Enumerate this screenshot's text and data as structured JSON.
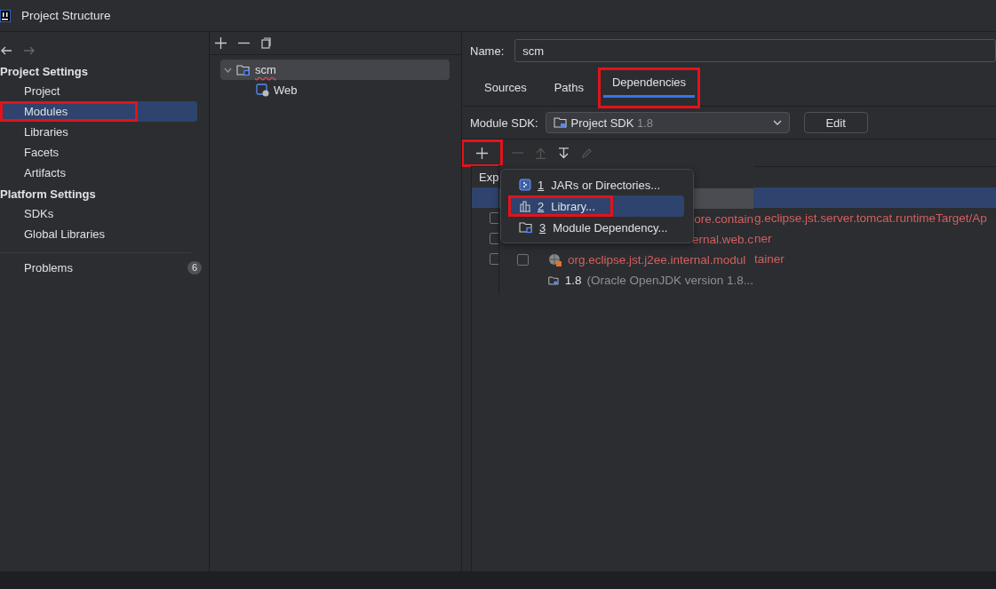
{
  "window": {
    "title": "Project Structure"
  },
  "sidebar": {
    "sections": [
      {
        "heading": "Project Settings",
        "items": [
          {
            "label": "Project",
            "selected": false,
            "highlighted": false
          },
          {
            "label": "Modules",
            "selected": true,
            "highlighted": true
          },
          {
            "label": "Libraries",
            "selected": false,
            "highlighted": false
          },
          {
            "label": "Facets",
            "selected": false,
            "highlighted": false
          },
          {
            "label": "Artifacts",
            "selected": false,
            "highlighted": false
          }
        ]
      },
      {
        "heading": "Platform Settings",
        "items": [
          {
            "label": "SDKs",
            "selected": false,
            "highlighted": false
          },
          {
            "label": "Global Libraries",
            "selected": false,
            "highlighted": false
          }
        ]
      }
    ],
    "problems": {
      "label": "Problems",
      "count": "6"
    }
  },
  "module_tree": [
    {
      "name": "scm",
      "selected": true,
      "expanded": true,
      "children": [
        {
          "name": "Web",
          "selected": false
        }
      ]
    }
  ],
  "name_field": {
    "label": "Name:",
    "value": "scm"
  },
  "tabs": [
    {
      "label": "Sources",
      "selected": false,
      "highlighted": false
    },
    {
      "label": "Paths",
      "selected": false,
      "highlighted": false
    },
    {
      "label": "Dependencies",
      "selected": true,
      "highlighted": true
    }
  ],
  "module_sdk": {
    "label": "Module SDK:",
    "value": "Project SDK",
    "version": "1.8",
    "button": "Edit"
  },
  "toolbar": [
    {
      "kind": "add",
      "disabled": false,
      "highlighted": true
    },
    {
      "kind": "remove",
      "disabled": true,
      "highlighted": false
    },
    {
      "kind": "up",
      "disabled": true,
      "highlighted": false
    },
    {
      "kind": "down",
      "disabled": false,
      "highlighted": false
    },
    {
      "kind": "edit",
      "disabled": true,
      "highlighted": false
    }
  ],
  "table": {
    "column_1": "Exp",
    "rows": [
      {
        "kind": "selected",
        "selected": true
      },
      {
        "kind": "item",
        "selected": false,
        "checked": false,
        "text": "g.eclipse.jst.server.tomcat.runtimeTarget/Ap"
      },
      {
        "kind": "item",
        "selected": false,
        "checked": false,
        "text": "ner"
      },
      {
        "kind": "item",
        "selected": false,
        "checked": false,
        "text": "tainer"
      }
    ]
  },
  "overlay_rows": [
    {
      "kind": "selected"
    },
    {
      "kind": "text",
      "text": "ore.contain"
    },
    {
      "kind": "text",
      "text": "ernal.web.c"
    },
    {
      "kind": "library",
      "checked": false,
      "text": "org.eclipse.jst.j2ee.internal.modul"
    },
    {
      "kind": "sdk",
      "text": "1.8",
      "detail": "(Oracle OpenJDK version 1.8..."
    }
  ],
  "popup_menu": [
    {
      "kind": "jar",
      "number": "1",
      "label": "JARs or Directories...",
      "selected": false,
      "highlighted": false
    },
    {
      "kind": "library",
      "number": "2",
      "label": "Library...",
      "selected": true,
      "highlighted": true
    },
    {
      "kind": "module",
      "number": "3",
      "label": "Module Dependency...",
      "selected": false,
      "highlighted": false
    }
  ]
}
